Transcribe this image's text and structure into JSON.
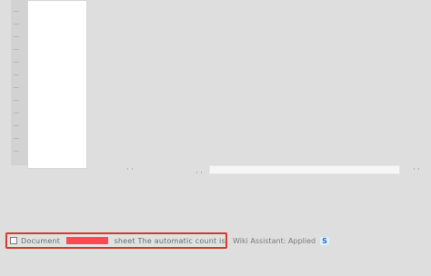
{
  "status": {
    "left_text_1": "Document",
    "left_text_2": "sheet The automatic count is",
    "right_text": "Wiki Assistant: Applied",
    "right_badge": "S"
  }
}
